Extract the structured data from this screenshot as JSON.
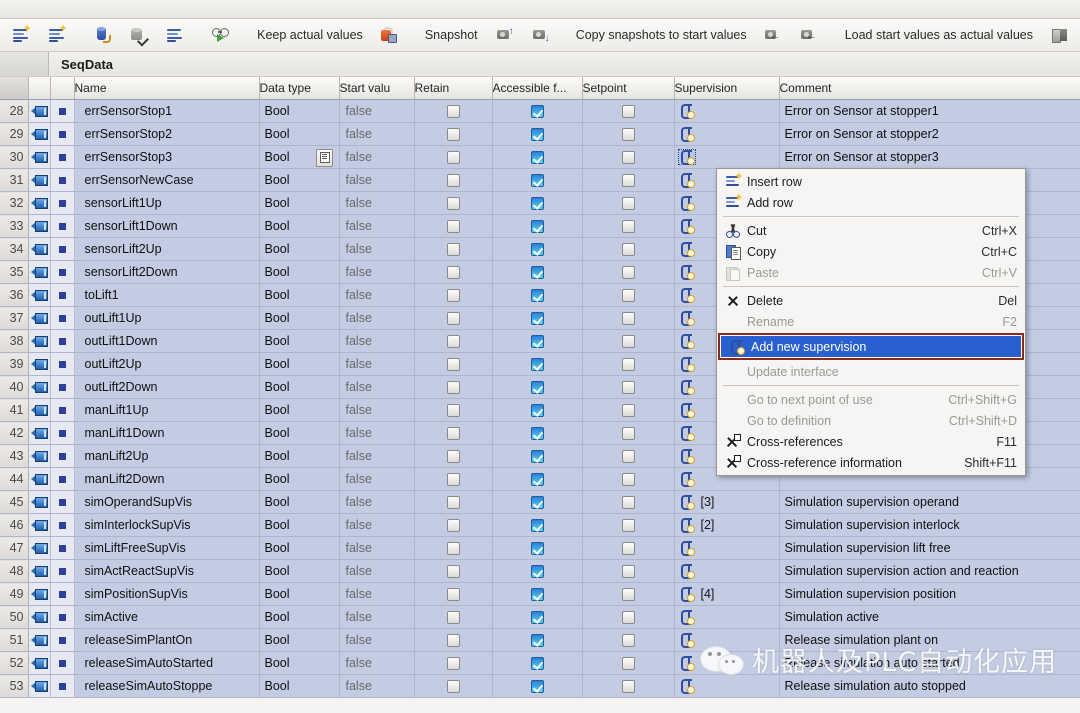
{
  "toolbar": {
    "icons": [
      {
        "name": "insert-row-icon"
      },
      {
        "name": "add-row-icon"
      },
      {
        "name": "retain-icon"
      },
      {
        "name": "set-retain-icon"
      },
      {
        "name": "data-block-list-icon"
      },
      {
        "name": "monitor-icon"
      }
    ],
    "keep_actual_values": "Keep actual values",
    "keep_actual_values_icon": "lock-icon",
    "snapshot": "Snapshot",
    "snapshot_icon_up": "snapshot-up-icon",
    "snapshot_icon_down": "snapshot-down-icon",
    "copy_snapshots": "Copy snapshots to start values",
    "copy_snapshot_icon_1": "copy-snapshot-all-icon",
    "copy_snapshot_icon_2": "copy-snapshot-selected-icon",
    "load_start_values": "Load start values as actual values",
    "load_icon": "load-start-values-icon"
  },
  "block": {
    "title": "SeqData"
  },
  "table": {
    "headers": {
      "gutter": "",
      "icon": "",
      "dot": "",
      "name": "Name",
      "data_type": "Data type",
      "start_value": "Start valu",
      "retain": "Retain",
      "accessible": "Accessible f...",
      "setpoint": "Setpoint",
      "supervision": "Supervision",
      "comment": "Comment"
    },
    "rows": [
      {
        "num": "28",
        "name": "errSensorStop1",
        "type": "Bool",
        "start": "false",
        "retain": false,
        "accessible": true,
        "setpoint": false,
        "sup_index": "",
        "comment": "Error on Sensor at stopper1",
        "sup_selected": false
      },
      {
        "num": "29",
        "name": "errSensorStop2",
        "type": "Bool",
        "start": "false",
        "retain": false,
        "accessible": true,
        "setpoint": false,
        "sup_index": "",
        "comment": "Error on Sensor at stopper2",
        "sup_selected": false
      },
      {
        "num": "30",
        "name": "errSensorStop3",
        "type": "Bool",
        "start": "false",
        "retain": false,
        "accessible": true,
        "setpoint": false,
        "sup_index": "",
        "comment": "Error on Sensor at stopper3",
        "sup_selected": true
      },
      {
        "num": "31",
        "name": "errSensorNewCase",
        "type": "Bool",
        "start": "false",
        "retain": false,
        "accessible": true,
        "setpoint": false,
        "sup_index": "",
        "comment": "",
        "sup_selected": false
      },
      {
        "num": "32",
        "name": "sensorLift1Up",
        "type": "Bool",
        "start": "false",
        "retain": false,
        "accessible": true,
        "setpoint": false,
        "sup_index": "",
        "comment": "",
        "sup_selected": false
      },
      {
        "num": "33",
        "name": "sensorLift1Down",
        "type": "Bool",
        "start": "false",
        "retain": false,
        "accessible": true,
        "setpoint": false,
        "sup_index": "",
        "comment": "",
        "sup_selected": false
      },
      {
        "num": "34",
        "name": "sensorLift2Up",
        "type": "Bool",
        "start": "false",
        "retain": false,
        "accessible": true,
        "setpoint": false,
        "sup_index": "",
        "comment": "",
        "sup_selected": false
      },
      {
        "num": "35",
        "name": "sensorLift2Down",
        "type": "Bool",
        "start": "false",
        "retain": false,
        "accessible": true,
        "setpoint": false,
        "sup_index": "",
        "comment": "",
        "sup_selected": false
      },
      {
        "num": "36",
        "name": "toLift1",
        "type": "Bool",
        "start": "false",
        "retain": false,
        "accessible": true,
        "setpoint": false,
        "sup_index": "",
        "comment": "",
        "sup_selected": false
      },
      {
        "num": "37",
        "name": "outLift1Up",
        "type": "Bool",
        "start": "false",
        "retain": false,
        "accessible": true,
        "setpoint": false,
        "sup_index": "",
        "comment": "",
        "sup_selected": false
      },
      {
        "num": "38",
        "name": "outLift1Down",
        "type": "Bool",
        "start": "false",
        "retain": false,
        "accessible": true,
        "setpoint": false,
        "sup_index": "",
        "comment": "",
        "sup_selected": false
      },
      {
        "num": "39",
        "name": "outLift2Up",
        "type": "Bool",
        "start": "false",
        "retain": false,
        "accessible": true,
        "setpoint": false,
        "sup_index": "",
        "comment": "",
        "sup_selected": false
      },
      {
        "num": "40",
        "name": "outLift2Down",
        "type": "Bool",
        "start": "false",
        "retain": false,
        "accessible": true,
        "setpoint": false,
        "sup_index": "",
        "comment": "",
        "sup_selected": false
      },
      {
        "num": "41",
        "name": "manLift1Up",
        "type": "Bool",
        "start": "false",
        "retain": false,
        "accessible": true,
        "setpoint": false,
        "sup_index": "",
        "comment": "",
        "sup_selected": false
      },
      {
        "num": "42",
        "name": "manLift1Down",
        "type": "Bool",
        "start": "false",
        "retain": false,
        "accessible": true,
        "setpoint": false,
        "sup_index": "",
        "comment": "",
        "sup_selected": false
      },
      {
        "num": "43",
        "name": "manLift2Up",
        "type": "Bool",
        "start": "false",
        "retain": false,
        "accessible": true,
        "setpoint": false,
        "sup_index": "",
        "comment": "",
        "sup_selected": false
      },
      {
        "num": "44",
        "name": "manLift2Down",
        "type": "Bool",
        "start": "false",
        "retain": false,
        "accessible": true,
        "setpoint": false,
        "sup_index": "",
        "comment": "",
        "sup_selected": false
      },
      {
        "num": "45",
        "name": "simOperandSupVis",
        "type": "Bool",
        "start": "false",
        "retain": false,
        "accessible": true,
        "setpoint": false,
        "sup_index": "[3]",
        "comment": "Simulation supervision operand",
        "sup_selected": false
      },
      {
        "num": "46",
        "name": "simInterlockSupVis",
        "type": "Bool",
        "start": "false",
        "retain": false,
        "accessible": true,
        "setpoint": false,
        "sup_index": "[2]",
        "comment": "Simulation supervision interlock",
        "sup_selected": false
      },
      {
        "num": "47",
        "name": "simLiftFreeSupVis",
        "type": "Bool",
        "start": "false",
        "retain": false,
        "accessible": true,
        "setpoint": false,
        "sup_index": "",
        "comment": "Simulation supervision lift free",
        "sup_selected": false
      },
      {
        "num": "48",
        "name": "simActReactSupVis",
        "type": "Bool",
        "start": "false",
        "retain": false,
        "accessible": true,
        "setpoint": false,
        "sup_index": "",
        "comment": "Simulation supervision action and reaction",
        "sup_selected": false
      },
      {
        "num": "49",
        "name": "simPositionSupVis",
        "type": "Bool",
        "start": "false",
        "retain": false,
        "accessible": true,
        "setpoint": false,
        "sup_index": "[4]",
        "comment": "Simulation supervision position",
        "sup_selected": false
      },
      {
        "num": "50",
        "name": "simActive",
        "type": "Bool",
        "start": "false",
        "retain": false,
        "accessible": true,
        "setpoint": false,
        "sup_index": "",
        "comment": "Simulation active",
        "sup_selected": false
      },
      {
        "num": "51",
        "name": "releaseSimPlantOn",
        "type": "Bool",
        "start": "false",
        "retain": false,
        "accessible": true,
        "setpoint": false,
        "sup_index": "",
        "comment": "Release simulation plant on",
        "sup_selected": false
      },
      {
        "num": "52",
        "name": "releaseSimAutoStarted",
        "type": "Bool",
        "start": "false",
        "retain": false,
        "accessible": true,
        "setpoint": false,
        "sup_index": "",
        "comment": "Release simulation auto started",
        "sup_selected": false
      },
      {
        "num": "53",
        "name": "releaseSimAutoStoppe",
        "type": "Bool",
        "start": "false",
        "retain": false,
        "accessible": true,
        "setpoint": false,
        "sup_index": "",
        "comment": "Release simulation auto stopped",
        "sup_selected": false
      }
    ]
  },
  "context_menu": {
    "items": [
      {
        "label": "Insert row",
        "shortcut": "",
        "icon": "insert-row-icon",
        "state": "normal"
      },
      {
        "label": "Add row",
        "shortcut": "",
        "icon": "add-row-icon",
        "state": "normal"
      },
      {
        "sep": true
      },
      {
        "label": "Cut",
        "shortcut": "Ctrl+X",
        "icon": "cut-icon",
        "state": "normal"
      },
      {
        "label": "Copy",
        "shortcut": "Ctrl+C",
        "icon": "copy-icon",
        "state": "normal"
      },
      {
        "label": "Paste",
        "shortcut": "Ctrl+V",
        "icon": "paste-icon",
        "state": "disabled"
      },
      {
        "sep": true
      },
      {
        "label": "Delete",
        "shortcut": "Del",
        "icon": "delete-icon",
        "state": "normal"
      },
      {
        "label": "Rename",
        "shortcut": "F2",
        "icon": "",
        "state": "disabled"
      },
      {
        "label": "Add new supervision",
        "shortcut": "",
        "icon": "supervision-icon",
        "state": "highlighted"
      },
      {
        "label": "Update interface",
        "shortcut": "",
        "icon": "",
        "state": "disabled"
      },
      {
        "sep": true
      },
      {
        "label": "Go to next point of use",
        "shortcut": "Ctrl+Shift+G",
        "icon": "",
        "state": "disabled"
      },
      {
        "label": "Go to definition",
        "shortcut": "Ctrl+Shift+D",
        "icon": "",
        "state": "disabled"
      },
      {
        "label": "Cross-references",
        "shortcut": "F11",
        "icon": "cross-reference-icon",
        "state": "normal"
      },
      {
        "label": "Cross-reference information",
        "shortcut": "Shift+F11",
        "icon": "cross-reference-info-icon",
        "state": "normal"
      }
    ]
  },
  "watermark": {
    "text": "机器人及PLC自动化应用",
    "icon": "wechat-icon"
  },
  "colors": {
    "row_background": "#c3cce3",
    "accent_checkbox": "#2d7fd6",
    "highlight": "#2a5fd0",
    "highlight_border": "#8a2b1e"
  }
}
